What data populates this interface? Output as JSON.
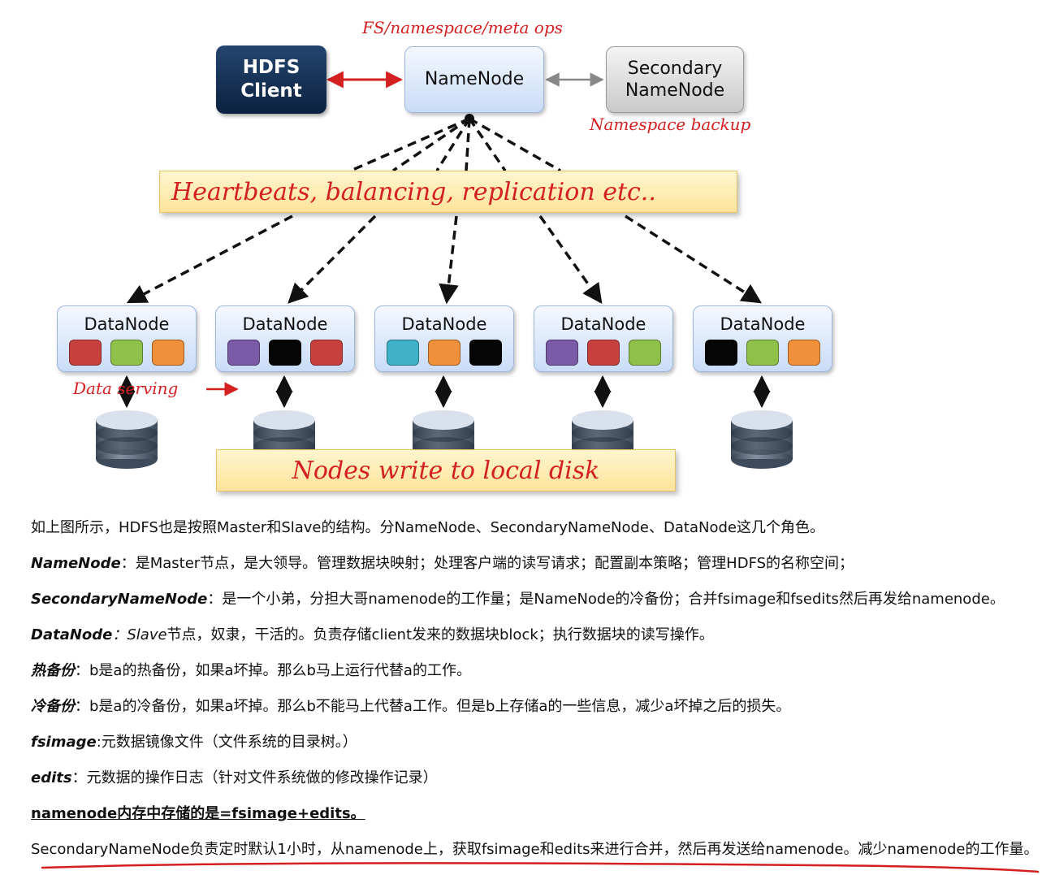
{
  "diagram": {
    "client": {
      "line1": "HDFS",
      "line2": "Client"
    },
    "namenode": {
      "label": "NameNode"
    },
    "secondary": {
      "line1": "Secondary",
      "line2": "NameNode"
    },
    "ops_note": "FS/namespace/meta ops",
    "backup_note": "Namespace backup",
    "heartbeat_banner": "Heartbeats, balancing, replication etc..",
    "data_serving_note": "Data serving",
    "disk_banner": "Nodes write to local disk",
    "datanodes": [
      {
        "label": "DataNode",
        "blocks": [
          "#c8403e",
          "#8fc04a",
          "#f0903a"
        ]
      },
      {
        "label": "DataNode",
        "blocks": [
          "#7a5aa6",
          "#050505",
          "#c8403e"
        ]
      },
      {
        "label": "DataNode",
        "blocks": [
          "#3fb2c8",
          "#f0903a",
          "#050505"
        ]
      },
      {
        "label": "DataNode",
        "blocks": [
          "#7a5aa6",
          "#c8403e",
          "#8fc04a"
        ]
      },
      {
        "label": "DataNode",
        "blocks": [
          "#050505",
          "#8fc04a",
          "#f0903a"
        ]
      }
    ],
    "colors": {
      "accent_red": "#d42020",
      "client_blue": "#0c2240",
      "namenode_blue": "#c9dcf7",
      "secondary_gray": "#c9c9c9",
      "banner_yellow": "#fde39a"
    }
  },
  "text": {
    "intro": "如上图所示，HDFS也是按照Master和Slave的结构。分NameNode、SecondaryNameNode、DataNode这几个角色。",
    "namenode": {
      "term": "NameNode",
      "desc": "：是Master节点，是大领导。管理数据块映射；处理客户端的读写请求；配置副本策略；管理HDFS的名称空间；"
    },
    "secondary": {
      "term": "SecondaryNameNode",
      "desc": "：是一个小弟，分担大哥namenode的工作量；是NameNode的冷备份；合并fsimage和fsedits然后再发给namenode。"
    },
    "datanode": {
      "term": "DataNode",
      "sep": "：",
      "slave": "Slave",
      "desc": "节点，奴隶，干活的。负责存储client发来的数据块block；执行数据块的读写操作。"
    },
    "hot": {
      "term": "热备份",
      "desc": "：b是a的热备份，如果a坏掉。那么b马上运行代替a的工作。"
    },
    "cold": {
      "term": "冷备份",
      "desc": "：b是a的冷备份，如果a坏掉。那么b不能马上代替a工作。但是b上存储a的一些信息，减少a坏掉之后的损失。"
    },
    "fsimage": {
      "term": "fsimage",
      "desc": ":元数据镜像文件（文件系统的目录树。）"
    },
    "edits": {
      "term": "edits",
      "desc": "：元数据的操作日志（针对文件系统做的修改操作记录）"
    },
    "memory": "namenode内存中存储的是=fsimage+edits。",
    "merge": "SecondaryNameNode负责定时默认1小时，从namenode上，获取fsimage和edits来进行合并，然后再发送给namenode。减少namenode的工作量。"
  }
}
